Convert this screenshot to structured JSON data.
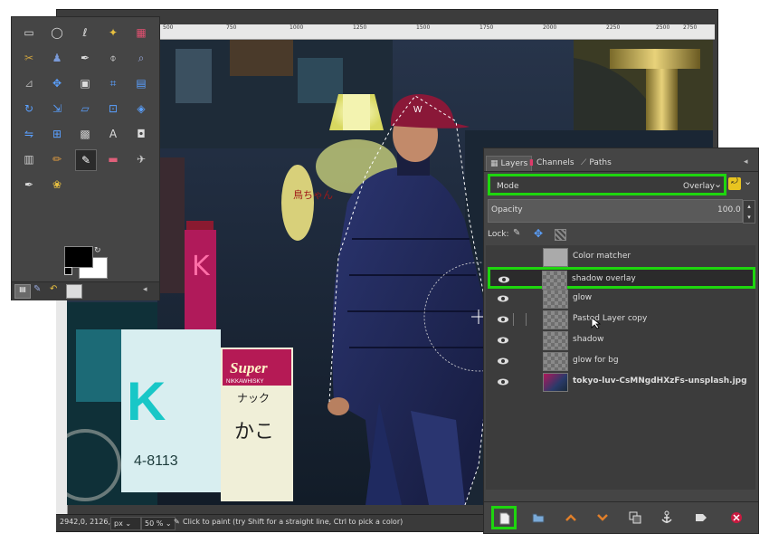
{
  "rulers": {
    "top_ticks": [
      "500",
      "750",
      "1000",
      "1250",
      "1500",
      "1750",
      "2000",
      "2250",
      "2500",
      "2750"
    ]
  },
  "canvas": {
    "sign_super": "Super",
    "sign_sub": "NIKKAWHISKY",
    "sign_kana1": "ナック",
    "sign_kana2": "かこ",
    "blue_number": "4-8113",
    "blue_letter": "K",
    "lantern_text": "鳥ちゃん",
    "red_kanji": "K",
    "cap_logo": "W"
  },
  "status": {
    "coords": "2942,0, 2126,0",
    "unit": "px",
    "zoom": "50 %",
    "message": "Click to paint (try Shift for a straight line, Ctrl to pick a color)"
  },
  "toolbox": {
    "tool_count": 32,
    "fg_color": "#000000",
    "bg_color": "#ffffff"
  },
  "layers_panel": {
    "tabs": [
      {
        "label": "Layers"
      },
      {
        "label": "Channels"
      },
      {
        "label": "Paths"
      }
    ],
    "mode_label": "Mode",
    "mode_value": "Overlay",
    "opacity_label": "Opacity",
    "opacity_value": "100.0",
    "lock_label": "Lock:",
    "layers": [
      {
        "name": "Color matcher",
        "visible": false
      },
      {
        "name": "shadow overlay",
        "visible": true,
        "selected": true
      },
      {
        "name": "glow",
        "visible": true
      },
      {
        "name": "Pasted Layer copy",
        "visible": true
      },
      {
        "name": "shadow",
        "visible": true
      },
      {
        "name": "glow for bg",
        "visible": true
      },
      {
        "name": "tokyo-luv-CsMNgdHXzFs-unsplash.jpg",
        "visible": true,
        "bold": true
      }
    ]
  },
  "colors": {
    "highlight": "#1ed60e",
    "panel_bg": "#454545",
    "accent_orange": "#e07f2a"
  }
}
